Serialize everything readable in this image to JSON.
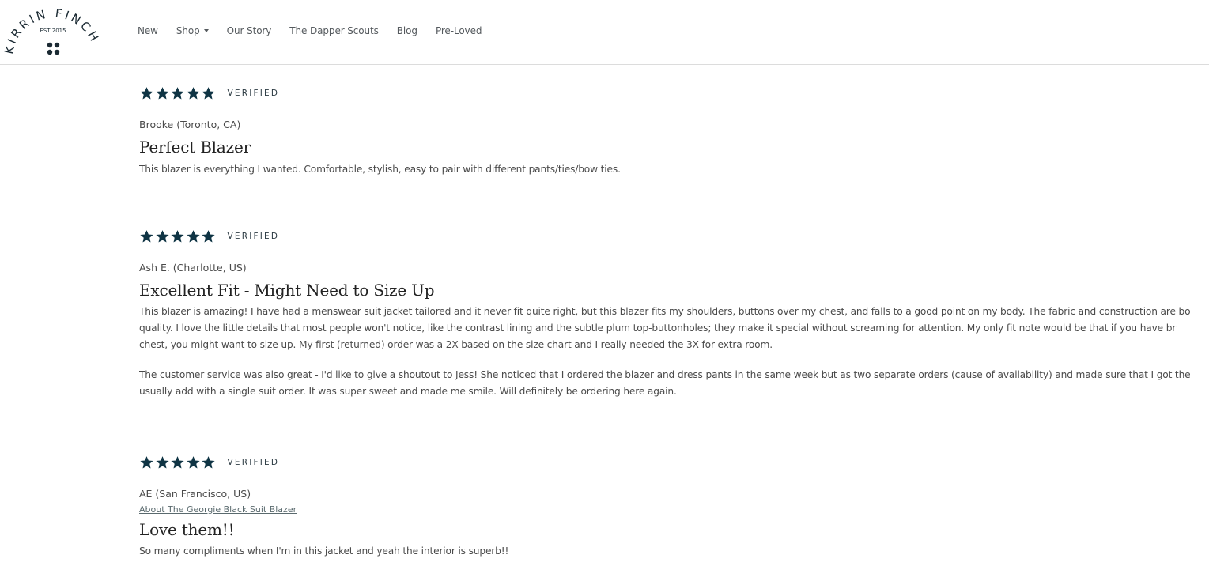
{
  "brand": {
    "name": "KIRRIN FINCH",
    "arc_left": "KIRRIN",
    "arc_right": "FINCH",
    "established": "EST 2015"
  },
  "nav": {
    "items": [
      {
        "label": "New",
        "has_dropdown": false
      },
      {
        "label": "Shop",
        "has_dropdown": true
      },
      {
        "label": "Our Story",
        "has_dropdown": false
      },
      {
        "label": "The Dapper Scouts",
        "has_dropdown": false
      },
      {
        "label": "Blog",
        "has_dropdown": false
      },
      {
        "label": "Pre-Loved",
        "has_dropdown": false
      }
    ]
  },
  "colors": {
    "star": "#0f3444",
    "text": "#4a4a4a",
    "title": "#222222",
    "divider": "#dcdcdc"
  },
  "reviews": [
    {
      "rating": 5,
      "max_rating": 5,
      "badge": "VERIFIED",
      "author": "Brooke (Toronto, CA)",
      "title": "Perfect Blazer",
      "paragraphs": [
        [
          "This blazer is everything I wanted. Comfortable, stylish, easy to pair with different pants/ties/bow ties."
        ]
      ]
    },
    {
      "rating": 5,
      "max_rating": 5,
      "badge": "VERIFIED",
      "author": "Ash E. (Charlotte, US)",
      "title": "Excellent Fit - Might Need to Size Up",
      "paragraphs": [
        [
          "This blazer is amazing! I have had a menswear suit jacket tailored and it never fit quite right, but this blazer fits my shoulders, buttons over my chest, and falls to a good point on my body. The fabric and construction are bo",
          "quality. I love the little details that most people won't notice, like the contrast lining and the subtle plum top-buttonholes; they make it special without screaming for attention. My only fit note would be that if you have br",
          "chest, you might want to size up. My first (returned) order was a 2X based on the size chart and I really needed the 3X for extra room."
        ],
        [
          "The customer service was also great - I'd like to give a shoutout to Jess! She noticed that I ordered the blazer and dress pants in the same week but as two separate orders (cause of availability) and made sure that I got the",
          "usually add with a single suit order. It was super sweet and made me smile. Will definitely be ordering here again."
        ]
      ]
    },
    {
      "rating": 5,
      "max_rating": 5,
      "badge": "VERIFIED",
      "author": "AE (San Francisco, US)",
      "product_link": "About The Georgie Black Suit Blazer",
      "title": "Love them!!",
      "paragraphs": [
        [
          "So many compliments when I'm in this jacket and yeah the interior is superb!!"
        ]
      ]
    }
  ]
}
